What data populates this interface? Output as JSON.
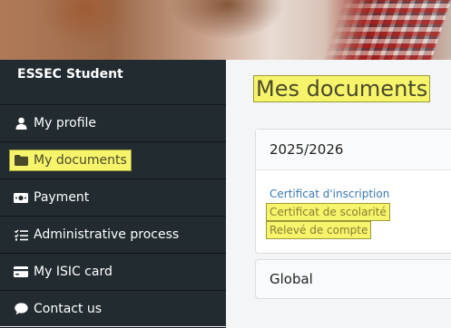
{
  "sidebar": {
    "brand": "ESSEC Student",
    "items": [
      {
        "label": "My profile",
        "icon": "user-icon",
        "active": false
      },
      {
        "label": "My documents",
        "icon": "folder-icon",
        "active": true
      },
      {
        "label": "Payment",
        "icon": "money-icon",
        "active": false
      },
      {
        "label": "Administrative process",
        "icon": "checklist-icon",
        "active": false
      },
      {
        "label": "My ISIC card",
        "icon": "card-icon",
        "active": false
      },
      {
        "label": "Contact us",
        "icon": "chat-icon",
        "active": false
      }
    ]
  },
  "main": {
    "title": "Mes documents",
    "year_card": {
      "header": "2025/2026",
      "links": [
        {
          "label": "Certificat d'inscription"
        },
        {
          "label": "Certificat de scolarité"
        },
        {
          "label": "Relevé de compte"
        }
      ]
    },
    "global_card": {
      "header": "Global"
    }
  },
  "colors": {
    "sidebar_bg": "#222b30",
    "highlight": "#f6f46b",
    "link": "#3b78b0"
  }
}
